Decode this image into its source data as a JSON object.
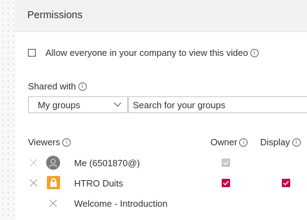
{
  "header": {
    "title": "Permissions"
  },
  "allow_everyone": {
    "label": "Allow everyone in your company to view this video",
    "checked": false
  },
  "shared_with": {
    "label": "Shared with",
    "selected": "My groups",
    "search_placeholder": "Search for your groups"
  },
  "viewers": {
    "header": "Viewers",
    "owner_header": "Owner",
    "display_header": "Display",
    "rows": [
      {
        "name": "Me (6501870@)",
        "avatar": "person-icon",
        "owner": true,
        "owner_disabled": true,
        "display": false
      },
      {
        "name": "HTRO Duits",
        "avatar": "lock-icon",
        "owner": true,
        "owner_disabled": false,
        "display": true
      },
      {
        "name": "Welcome - Introduction",
        "avatar": "",
        "owner": false,
        "display": false
      }
    ]
  },
  "colors": {
    "accent": "#c30052",
    "lock": "#f2a32b",
    "header_bg": "#f3f2f1"
  }
}
